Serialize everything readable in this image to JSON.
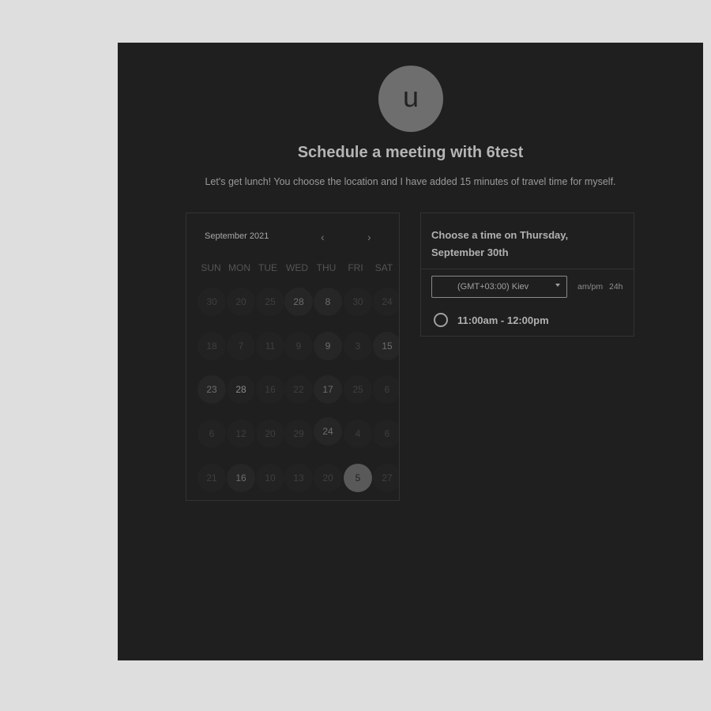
{
  "header": {
    "avatar_letter": "u",
    "title": "Schedule a meeting with 6test",
    "description": "Let's get lunch! You choose the location and I have added 15 minutes of travel time for myself."
  },
  "calendar": {
    "month_label": "September 2021",
    "prev_icon": "‹",
    "next_icon": "›",
    "weekdays": [
      "SUN",
      "MON",
      "TUE",
      "WED",
      "THU",
      "FRI",
      "SAT"
    ],
    "weeks": [
      [
        "30",
        "20",
        "25",
        "28",
        "8",
        "30",
        "24"
      ],
      [
        "18",
        "7",
        "11",
        "9",
        "9",
        "3",
        "15"
      ],
      [
        "23",
        "28",
        "16",
        "22",
        "17",
        "25",
        "6"
      ],
      [
        "6",
        "12",
        "20",
        "29",
        "24",
        "4",
        "6"
      ],
      [
        "21",
        "16",
        "10",
        "13",
        "20",
        "5",
        "27"
      ]
    ],
    "selected_day": "5"
  },
  "times": {
    "heading": "Choose a time on Thursday, September 30th",
    "timezone": "(GMT+03:00) Kiev",
    "format_ampm": "am/pm",
    "format_24h": "24h",
    "slots": [
      "11:00am - 12:00pm"
    ]
  }
}
